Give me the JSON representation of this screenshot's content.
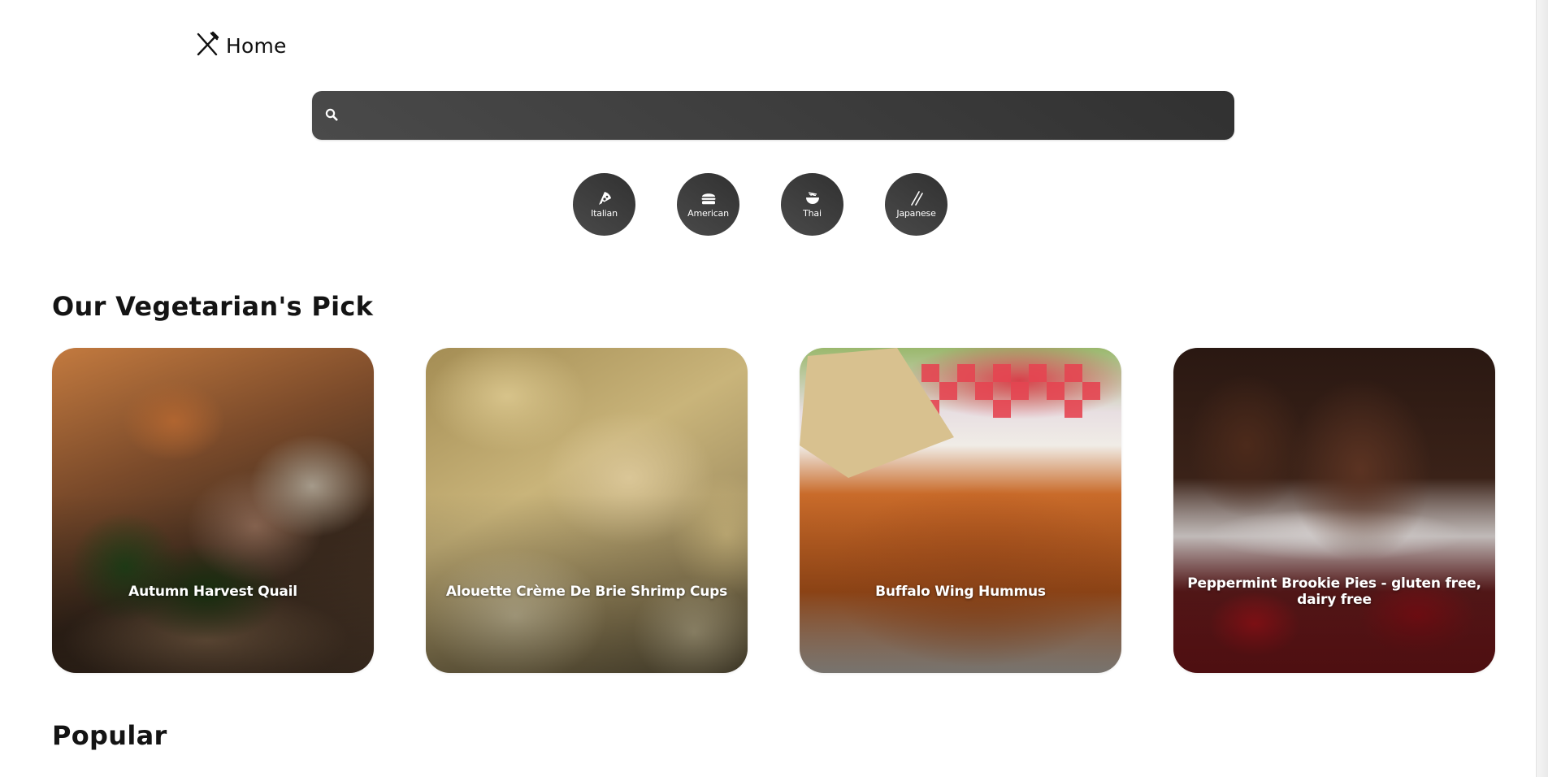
{
  "nav": {
    "home_label": "Home",
    "home_icon": "utensils-crossed-icon"
  },
  "search": {
    "value": "",
    "placeholder": "",
    "icon": "search-icon"
  },
  "cuisines": [
    {
      "label": "Italian",
      "icon": "pizza-icon"
    },
    {
      "label": "American",
      "icon": "burger-icon"
    },
    {
      "label": "Thai",
      "icon": "noodle-bowl-icon"
    },
    {
      "label": "Japanese",
      "icon": "chopsticks-icon"
    }
  ],
  "veggie": {
    "title": "Our Vegetarian's Pick",
    "cards": [
      {
        "title": "Autumn Harvest Quail"
      },
      {
        "title": "Alouette Crème De Brie Shrimp Cups"
      },
      {
        "title": "Buffalo Wing Hummus"
      },
      {
        "title": "Peppermint Brookie Pies - gluten free, dairy free"
      }
    ]
  },
  "popular": {
    "title": "Popular"
  },
  "colors": {
    "dark_pill": "#3a3a3a",
    "text": "#141414",
    "card_text": "#ffffff"
  }
}
